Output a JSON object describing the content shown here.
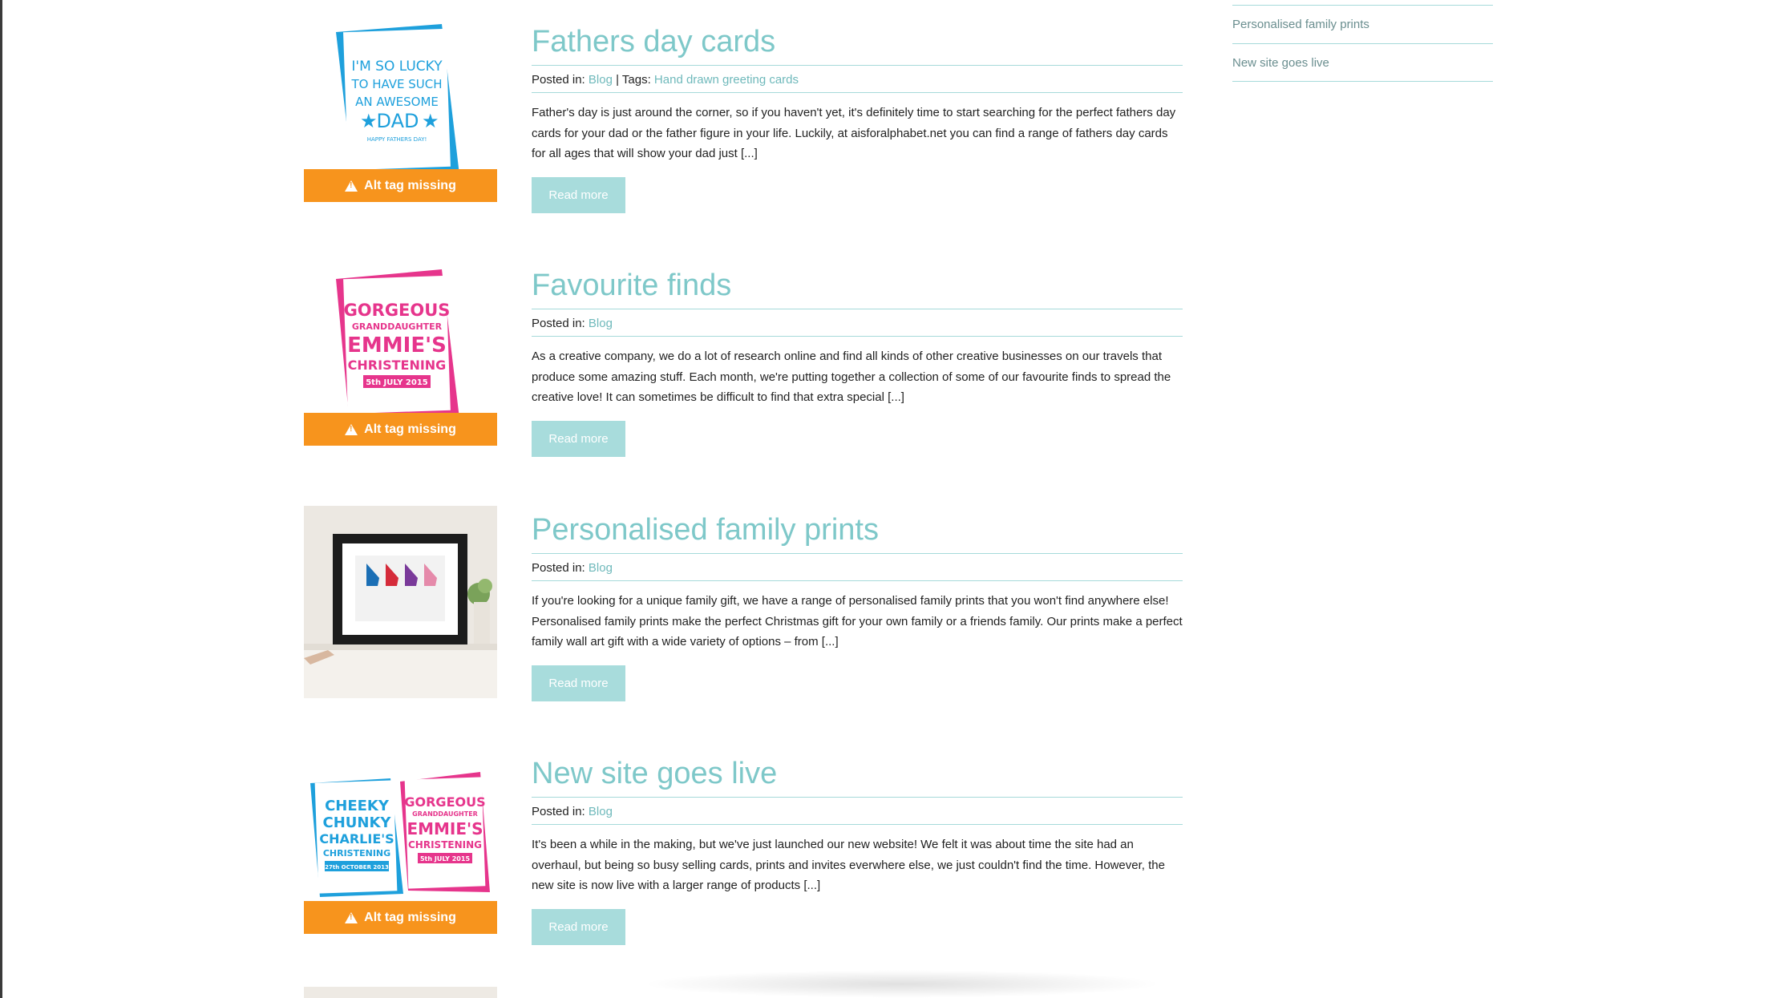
{
  "sidebar": {
    "items": [
      {
        "label": "Personalised family prints"
      },
      {
        "label": "New site goes live"
      }
    ]
  },
  "posts": [
    {
      "title": "Fathers day cards",
      "meta_prefix": "Posted in:",
      "category": "Blog",
      "tags_prefix": "| Tags:",
      "tag": "Hand drawn greeting cards",
      "excerpt": "Father's day is just around the corner, so if you haven't yet, it's definitely time to start searching for the perfect fathers day cards for your dad or the father figure in your life. Luckily, at aisforalphabet.net you can find a range of fathers day cards for all ages that will show your dad just [...]",
      "read_more": "Read more",
      "alt_warning": "Alt tag missing",
      "card_text": [
        "I'M SO LUCKY",
        "TO HAVE SUCH",
        "AN AWESOME",
        "DAD",
        "HAPPY FATHERS DAY!"
      ]
    },
    {
      "title": "Favourite finds",
      "meta_prefix": "Posted in:",
      "category": "Blog",
      "excerpt": "As a creative company, we do a lot of research online and find all kinds of other creative businesses on our travels that produce some amazing stuff. Each month, we're putting together a collection of some of our favourite finds to spread the creative love! It can sometimes be difficult to find that extra special [...]",
      "read_more": "Read more",
      "alt_warning": "Alt tag missing",
      "card_text": [
        "GORGEOUS",
        "GRANDDAUGHTER",
        "EMMIE'S",
        "CHRISTENING",
        "5th JULY 2015"
      ]
    },
    {
      "title": "Personalised family prints",
      "meta_prefix": "Posted in:",
      "category": "Blog",
      "excerpt": "If you're looking for a unique family gift, we have a range of personalised family prints that you won't find anywhere else! Personalised family prints make the perfect Christmas gift for your own family or a friends family. Our prints make a perfect family wall art gift with a wide variety of options – from [...]",
      "read_more": "Read more"
    },
    {
      "title": "New site goes live",
      "meta_prefix": "Posted in:",
      "category": "Blog",
      "excerpt": "It's been a while in the making, but we've just launched our new website! We felt it was about time the site had an overhaul, but being so busy selling cards, prints and invites everwhere else, we just couldn't find the time. However, the new site is now live with a larger range of products [...]",
      "read_more": "Read more",
      "alt_warning": "Alt tag missing",
      "card_text": [
        "CHEEKY",
        "CHUNKY",
        "CHARLIE'S",
        "CHRISTENING",
        "27th OCTOBER 2013",
        "GORGEOUS",
        "GRANDDAUGHTER",
        "EMMIE'S",
        "CHRISTENING",
        "5th JULY 2015"
      ]
    }
  ],
  "colors": {
    "accent": "#7ec8c9",
    "button": "#a8dcdc",
    "warning": "#f7941d",
    "blue_card": "#1ea0dc",
    "pink_card": "#e6358c"
  }
}
